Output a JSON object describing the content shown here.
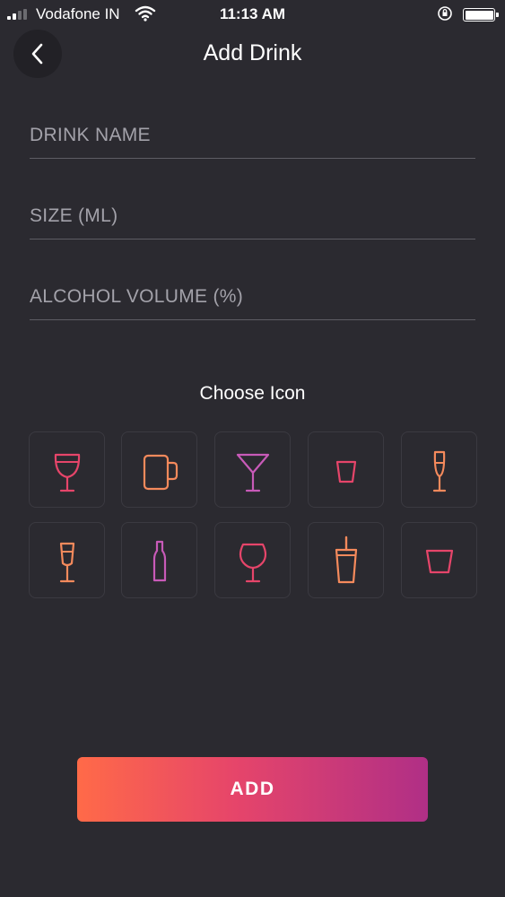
{
  "status_bar": {
    "carrier": "Vodafone IN",
    "time": "11:13 AM"
  },
  "header": {
    "title": "Add Drink",
    "back_icon": "chevron-left-icon"
  },
  "form": {
    "drink_name": {
      "value": "",
      "placeholder": "DRINK NAME"
    },
    "size": {
      "value": "",
      "placeholder": "SIZE (ML)"
    },
    "alcohol_volume": {
      "value": "",
      "placeholder": "ALCOHOL VOLUME (%)"
    }
  },
  "icons": {
    "title": "Choose Icon",
    "items": [
      "wine-glass-icon",
      "beer-mug-icon",
      "martini-glass-icon",
      "shot-glass-icon",
      "flute-glass-icon",
      "champagne-glass-icon",
      "bottle-icon",
      "goblet-icon",
      "cup-with-straw-icon",
      "tumbler-glass-icon"
    ]
  },
  "actions": {
    "add_label": "ADD"
  },
  "colors": {
    "background": "#2b2a30",
    "gradient_start": "#ff6a48",
    "gradient_end": "#b02f86",
    "icon_pink": "#e6456a",
    "icon_orange": "#f58a5c",
    "icon_purple": "#c85ab8"
  }
}
